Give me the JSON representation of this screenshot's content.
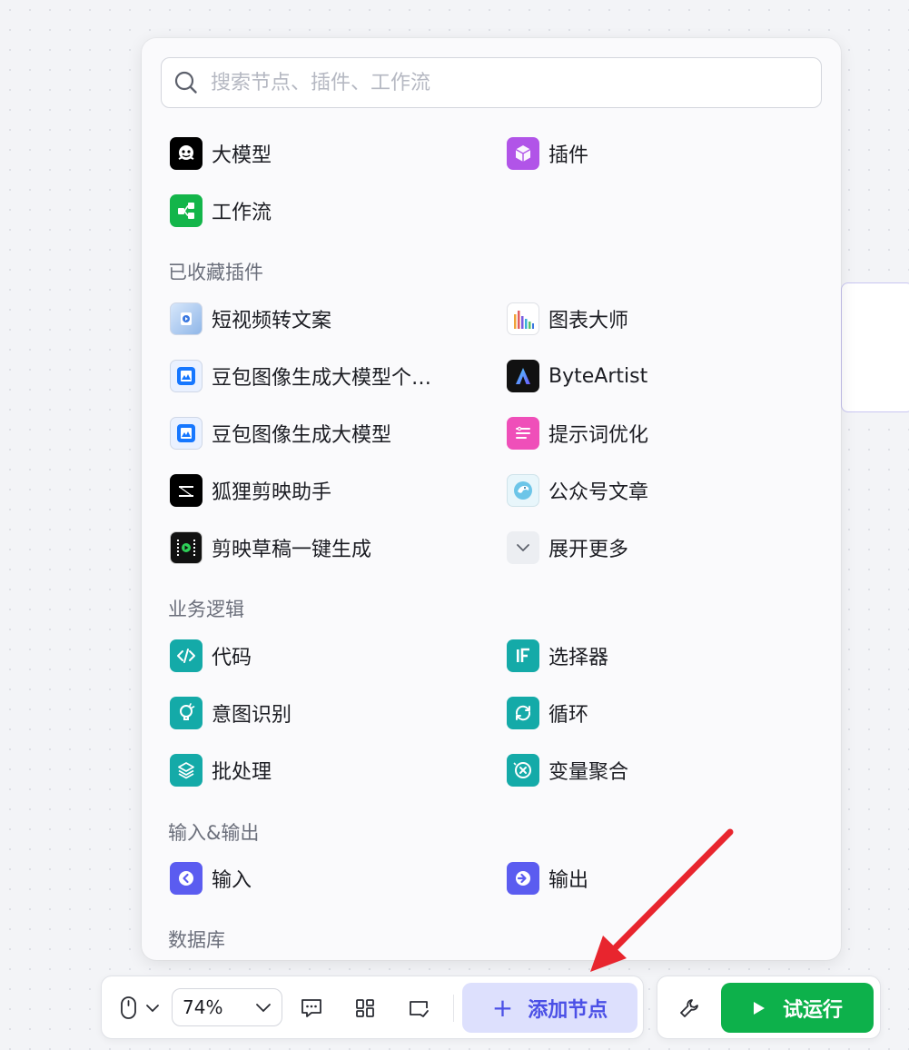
{
  "search": {
    "placeholder": "搜索节点、插件、工作流"
  },
  "top_items": [
    {
      "label": "大模型",
      "icon": "llm-icon",
      "color": "#000000"
    },
    {
      "label": "插件",
      "icon": "plugin-cube-icon",
      "color": "#b154e8"
    },
    {
      "label": "工作流",
      "icon": "workflow-icon",
      "color": "#13b54a"
    }
  ],
  "sections": {
    "favorites": {
      "title": "已收藏插件",
      "items": [
        {
          "label": "短视频转文案",
          "icon": "video-to-text-icon"
        },
        {
          "label": "图表大师",
          "icon": "chart-master-icon"
        },
        {
          "label": "豆包图像生成大模型个…",
          "icon": "image-gen-icon",
          "color": "#1677ff"
        },
        {
          "label": "ByteArtist",
          "icon": "byteartist-icon"
        },
        {
          "label": "豆包图像生成大模型",
          "icon": "image-gen-icon",
          "color": "#1677ff"
        },
        {
          "label": "提示词优化",
          "icon": "prompt-optimize-icon",
          "color": "#ef4fb9"
        },
        {
          "label": "狐狸剪映助手",
          "icon": "capcut-icon",
          "color": "#000000"
        },
        {
          "label": "公众号文章",
          "icon": "article-icon"
        },
        {
          "label": "剪映草稿一键生成",
          "icon": "film-draft-icon"
        },
        {
          "label": "展开更多",
          "icon": "chevron-down-icon"
        }
      ]
    },
    "logic": {
      "title": "业务逻辑",
      "items": [
        {
          "label": "代码",
          "icon": "code-icon",
          "color": "#14aaa8"
        },
        {
          "label": "选择器",
          "icon": "if-selector-icon",
          "color": "#14aaa8"
        },
        {
          "label": "意图识别",
          "icon": "intent-icon",
          "color": "#14aaa8"
        },
        {
          "label": "循环",
          "icon": "loop-icon",
          "color": "#14aaa8"
        },
        {
          "label": "批处理",
          "icon": "batch-icon",
          "color": "#14aaa8"
        },
        {
          "label": "变量聚合",
          "icon": "variable-merge-icon",
          "color": "#14aaa8"
        }
      ]
    },
    "io": {
      "title": "输入&输出",
      "items": [
        {
          "label": "输入",
          "icon": "input-icon",
          "color": "#5b5cf0"
        },
        {
          "label": "输出",
          "icon": "output-icon",
          "color": "#5b5cf0"
        }
      ]
    },
    "database": {
      "title": "数据库"
    }
  },
  "toolbar": {
    "zoom": "74%",
    "add_node_label": "添加节点",
    "run_label": "试运行",
    "accent": "#4b50e6",
    "run_color": "#0db14b"
  }
}
